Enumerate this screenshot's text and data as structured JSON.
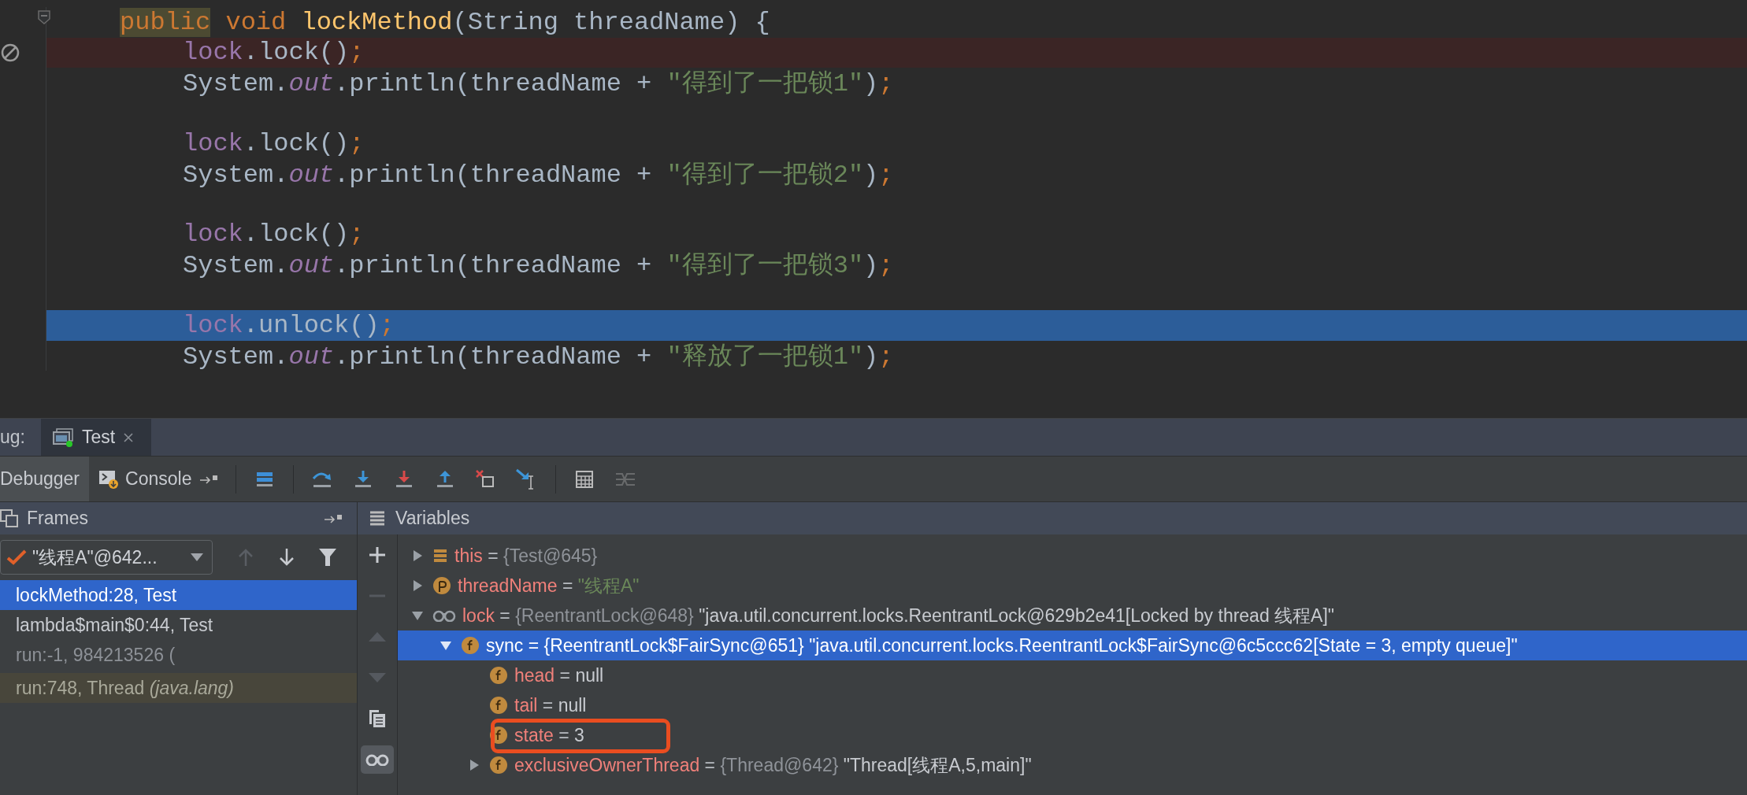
{
  "editor": {
    "lines": [
      {
        "kind": "code",
        "tokens": [
          {
            "kind": "keyword_match",
            "text": "public"
          },
          {
            "kind": "keyword",
            "text": " void"
          },
          {
            "kind": "method",
            "text": " lockMethod"
          },
          {
            "kind": "plain",
            "text": "(String threadName) {"
          }
        ],
        "children": [
          {
            "kind": "breakpoint",
            "tokens": [
              {
                "kind": "field",
                "text": "lock"
              },
              {
                "kind": "plain",
                "text": ".lock()"
              },
              {
                "kind": "semi",
                "text": ";"
              }
            ]
          },
          {
            "kind": "code",
            "tokens": [
              {
                "kind": "plain",
                "text": "System."
              },
              {
                "kind": "static",
                "text": "out"
              },
              {
                "kind": "plain",
                "text": ".println(threadName + "
              },
              {
                "kind": "string",
                "text": "\"得到了一把锁1\""
              },
              {
                "kind": "plain",
                "text": ")"
              },
              {
                "kind": "semi",
                "text": ";"
              }
            ]
          },
          {
            "kind": "blank"
          },
          {
            "kind": "code",
            "tokens": [
              {
                "kind": "field",
                "text": "lock"
              },
              {
                "kind": "plain",
                "text": ".lock()"
              },
              {
                "kind": "semi",
                "text": ";"
              }
            ]
          },
          {
            "kind": "code",
            "tokens": [
              {
                "kind": "plain",
                "text": "System."
              },
              {
                "kind": "static",
                "text": "out"
              },
              {
                "kind": "plain",
                "text": ".println(threadName + "
              },
              {
                "kind": "string",
                "text": "\"得到了一把锁2\""
              },
              {
                "kind": "plain",
                "text": ")"
              },
              {
                "kind": "semi",
                "text": ";"
              }
            ]
          },
          {
            "kind": "blank"
          },
          {
            "kind": "code",
            "tokens": [
              {
                "kind": "field",
                "text": "lock"
              },
              {
                "kind": "plain",
                "text": ".lock()"
              },
              {
                "kind": "semi",
                "text": ";"
              }
            ]
          },
          {
            "kind": "code",
            "tokens": [
              {
                "kind": "plain",
                "text": "System."
              },
              {
                "kind": "static",
                "text": "out"
              },
              {
                "kind": "plain",
                "text": ".println(threadName + "
              },
              {
                "kind": "string",
                "text": "\"得到了一把锁3\""
              },
              {
                "kind": "plain",
                "text": ")"
              },
              {
                "kind": "semi",
                "text": ";"
              }
            ]
          },
          {
            "kind": "blank"
          },
          {
            "kind": "current",
            "tokens": [
              {
                "kind": "field",
                "text": "lock"
              },
              {
                "kind": "plain",
                "text": ".unlock()"
              },
              {
                "kind": "semi",
                "text": ";"
              }
            ]
          },
          {
            "kind": "code",
            "tokens": [
              {
                "kind": "plain",
                "text": "System."
              },
              {
                "kind": "static",
                "text": "out"
              },
              {
                "kind": "plain",
                "text": ".println(threadName + "
              },
              {
                "kind": "string",
                "text": "\"释放了一把锁1\""
              },
              {
                "kind": "plain",
                "text": ")"
              },
              {
                "kind": "semi",
                "text": ";"
              }
            ]
          }
        ]
      }
    ]
  },
  "debug_bar": {
    "label": "ug:",
    "tabs": [
      {
        "label": "Test",
        "selected": true
      }
    ]
  },
  "toolbar": {
    "views": [
      {
        "kind": "debugger",
        "label": "Debugger",
        "selected": true
      },
      {
        "kind": "console",
        "label": "Console",
        "selected": false
      }
    ],
    "tools": [
      {
        "kind": "layout",
        "disabled": false
      },
      {
        "kind": "step_over",
        "disabled": false
      },
      {
        "kind": "step_into",
        "disabled": false
      },
      {
        "kind": "force_step_into",
        "disabled": false
      },
      {
        "kind": "step_out",
        "disabled": false
      },
      {
        "kind": "drop_frame",
        "disabled": false
      },
      {
        "kind": "run_to_cursor",
        "disabled": false
      },
      {
        "kind": "evaluate",
        "disabled": false
      },
      {
        "kind": "trace",
        "disabled": true
      }
    ]
  },
  "frames": {
    "title": "Frames",
    "thread": "\"线程A\"@642...",
    "nav": [
      {
        "kind": "up",
        "disabled": true
      },
      {
        "kind": "down",
        "disabled": false
      },
      {
        "kind": "filter",
        "disabled": false
      }
    ],
    "items": [
      {
        "kind": "frame",
        "text": "lockMethod:28, Test",
        "selected": true
      },
      {
        "kind": "frame",
        "text": "lambda$main$0:44, Test",
        "selected": false
      },
      {
        "kind": "synthetic",
        "text": "run:-1, 984213526 (",
        "selected": false
      },
      {
        "kind": "library",
        "text": "run:748, Thread *(java.lang)*",
        "selected": false
      }
    ]
  },
  "variables": {
    "title": "Variables",
    "tools": [
      {
        "kind": "add",
        "disabled": false,
        "on": false
      },
      {
        "kind": "remove",
        "disabled": true,
        "on": false
      },
      {
        "kind": "up",
        "disabled": true,
        "on": false
      },
      {
        "kind": "down",
        "disabled": true,
        "on": false
      },
      {
        "kind": "copy",
        "disabled": false,
        "on": false
      },
      {
        "kind": "watches",
        "disabled": false,
        "on": true
      }
    ],
    "items": [
      {
        "kind": "object",
        "name": "this",
        "operator": "=",
        "ref": "{Test@645}",
        "expanded": false,
        "selected": false,
        "outlined": false
      },
      {
        "kind": "param",
        "name": "threadName",
        "operator": "=",
        "value": "\"线程A\"",
        "expanded": false,
        "selected": false,
        "outlined": false
      },
      {
        "kind": "watch",
        "name": "lock",
        "operator": "=",
        "ref": "{ReentrantLock@648}",
        "value": "\"java.util.concurrent.locks.ReentrantLock@629b2e41[Locked by thread 线程A]\"",
        "expanded": true,
        "selected": false,
        "outlined": false,
        "children": [
          {
            "kind": "field",
            "name": "sync",
            "operator": "=",
            "ref": "{ReentrantLock$FairSync@651}",
            "value": "\"java.util.concurrent.locks.ReentrantLock$FairSync@6c5ccc62[State = 3, empty queue]\"",
            "expanded": true,
            "selected": true,
            "outlined": false,
            "children": [
              {
                "kind": "field",
                "name": "head",
                "operator": "=",
                "value": "null",
                "selected": false,
                "outlined": false
              },
              {
                "kind": "field",
                "name": "tail",
                "operator": "=",
                "value": "null",
                "selected": false,
                "outlined": false
              },
              {
                "kind": "field",
                "name": "state",
                "operator": "=",
                "value": "3",
                "selected": false,
                "outlined": true
              },
              {
                "kind": "field",
                "name": "exclusiveOwnerThread",
                "operator": "=",
                "ref": "{Thread@642}",
                "value": "\"Thread[线程A,5,main]\"",
                "expanded": false,
                "selected": false,
                "outlined": false
              }
            ]
          }
        ]
      }
    ]
  }
}
